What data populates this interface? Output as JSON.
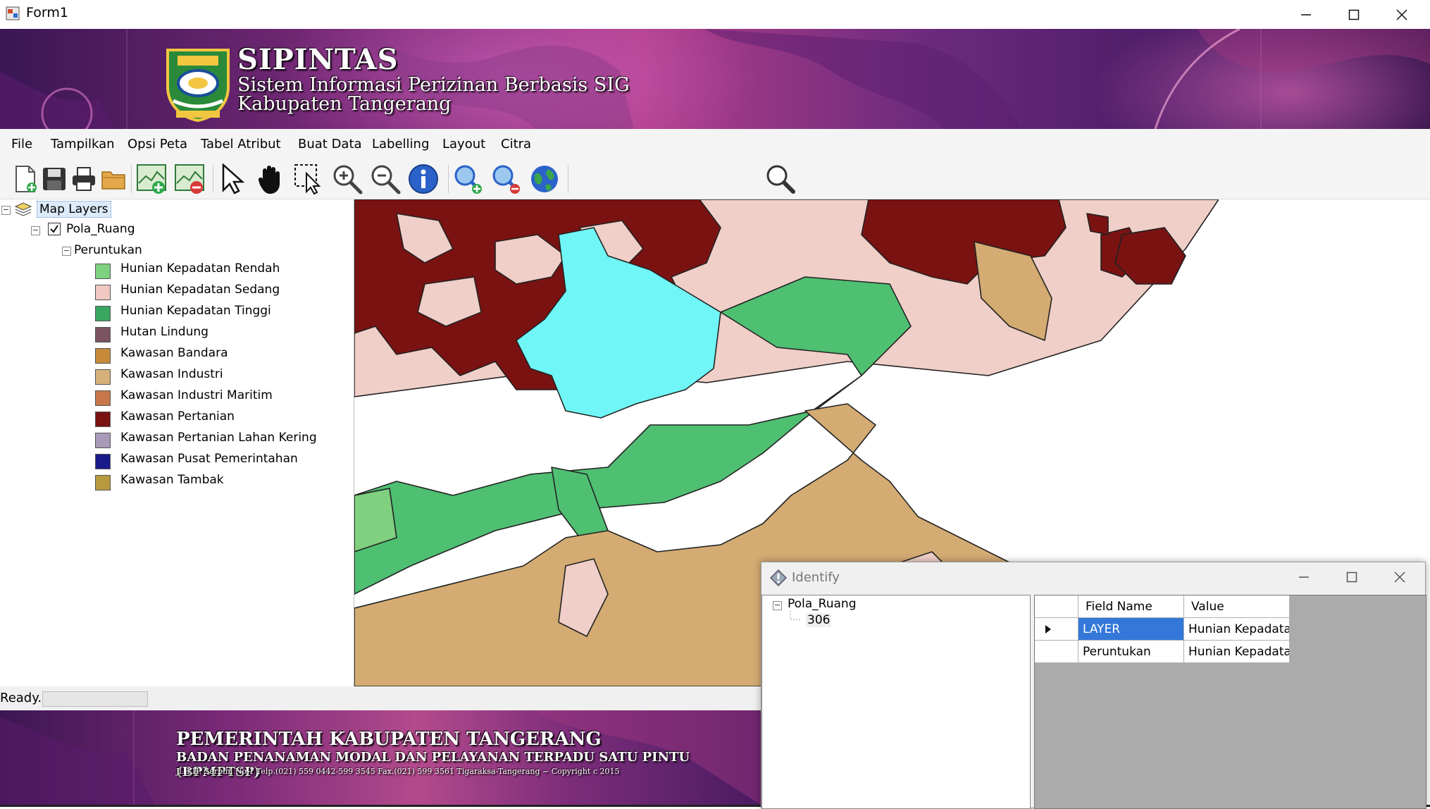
{
  "window": {
    "title": "Form1",
    "icon": "app-form-icon",
    "controls": [
      "minimize-icon",
      "maximize-icon",
      "close-icon"
    ]
  },
  "banner": {
    "title": "SIPINTAS",
    "subtitle": "Sistem Informasi Perizinan Berbasis SIG",
    "region": "Kabupaten Tangerang",
    "logo": "kabupaten-tangerang-crest"
  },
  "menu": [
    "File",
    "Tampilkan",
    "Opsi Peta",
    "Tabel Atribut",
    "Buat Data",
    "Labelling",
    "Layout",
    "Citra"
  ],
  "toolbar": {
    "tools": [
      "new-file-icon",
      "save-icon",
      "print-icon",
      "open-folder-icon",
      "add-layer-icon",
      "remove-layer-icon",
      "select-arrow-icon",
      "pan-hand-icon",
      "select-box-icon",
      "zoom-in-icon",
      "zoom-out-icon",
      "info-icon",
      "zoom-in-fixed-icon",
      "zoom-out-fixed-icon",
      "full-extent-globe-icon"
    ],
    "search_value": "",
    "search_icon": "search-icon"
  },
  "layers": {
    "root": "Map Layers",
    "layer": "Pola_Ruang",
    "layer_checked": true,
    "field": "Peruntukan",
    "legend": [
      {
        "label": "Hunian Kepadatan Rendah",
        "color": "#7fd07f"
      },
      {
        "label": "Hunian Kepadatan Sedang",
        "color": "#f0c9c3"
      },
      {
        "label": "Hunian Kepadatan Tinggi",
        "color": "#3aa660"
      },
      {
        "label": "Hutan Lindung",
        "color": "#7b5460"
      },
      {
        "label": "Kawasan Bandara",
        "color": "#c68a3a"
      },
      {
        "label": "Kawasan Industri",
        "color": "#d5b07a"
      },
      {
        "label": "Kawasan Industri Maritim",
        "color": "#c7774b"
      },
      {
        "label": "Kawasan Pertanian",
        "color": "#7a1212"
      },
      {
        "label": "Kawasan Pertanian Lahan Kering",
        "color": "#a89ab8"
      },
      {
        "label": "Kawasan Pusat Pemerintahan",
        "color": "#1a1a8a"
      },
      {
        "label": "Kawasan Tambak",
        "color": "#b89a3e"
      }
    ]
  },
  "map": {
    "colors": {
      "pertanian": "#7a1212",
      "sedang": "#f0cfc8",
      "tinggi": "#4fbf72",
      "industri": "#d3ab73",
      "selected": "#70f6f6",
      "border": "#222222"
    }
  },
  "status": {
    "text": "Ready."
  },
  "footer": {
    "line1": "PEMERINTAH KABUPATEN TANGERANG",
    "line2": "BADAN PENANAMAN MODAL DAN PELAYANAN TERPADU SATU PINTU (BPMPTSP)",
    "line3": "Jl. KH. Sarbini No.1 Telp.(021) 559 0442-599 3545 Fax.(021) 599 3561 Tigaraksa-Tangerang ~ Copyright c 2015"
  },
  "identify": {
    "title": "Identify",
    "icon": "identify-diamond-icon",
    "tree": {
      "layer": "Pola_Ruang",
      "feature": "306"
    },
    "grid": {
      "headers": [
        "Field Name",
        "Value"
      ],
      "rows": [
        {
          "field": "LAYER",
          "value": "Hunian Kepadata...",
          "selected": true
        },
        {
          "field": "Peruntukan",
          "value": "Hunian Kepadata...",
          "selected": false
        }
      ]
    }
  }
}
